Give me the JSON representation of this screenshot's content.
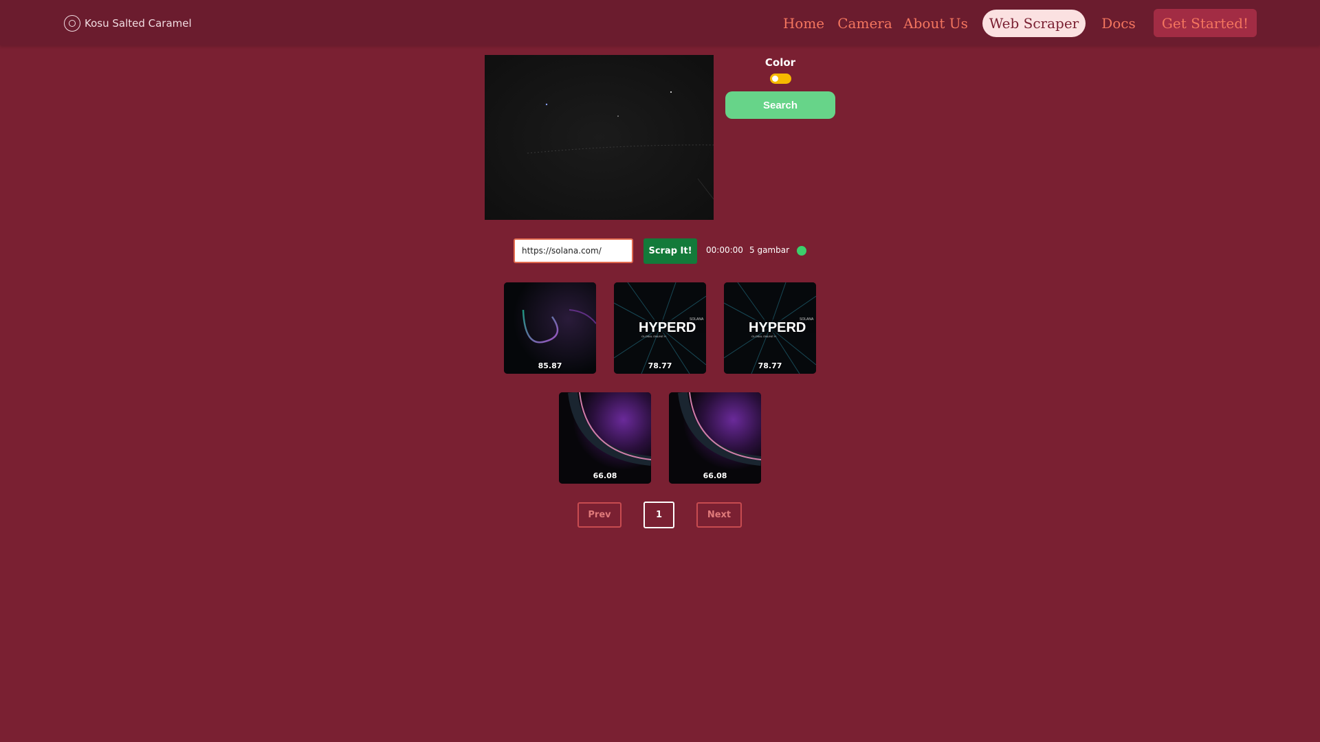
{
  "brand": {
    "name": "Kosu Salted Caramel",
    "icon": "logo-icon"
  },
  "nav": {
    "home": "Home",
    "camera": "Camera",
    "about": "About Us",
    "scraper": "Web Scraper",
    "docs": "Docs",
    "cta": "Get Started!"
  },
  "camera_panel": {
    "color_label": "Color",
    "color_toggle_on": true,
    "search_label": "Search"
  },
  "scraper": {
    "url_value": "https://solana.com/",
    "button_label": "Scrap It!",
    "timer": "00:00:00",
    "count": "5 gambar",
    "status_color": "#3dce6c"
  },
  "results": [
    {
      "score": "85.87",
      "image": "aurora-arc"
    },
    {
      "score": "78.77",
      "image": "hyperdrive-banner"
    },
    {
      "score": "78.77",
      "image": "hyperdrive-banner"
    },
    {
      "score": "66.08",
      "image": "purple-eclipse"
    },
    {
      "score": "66.08",
      "image": "purple-eclipse"
    }
  ],
  "pagination": {
    "prev": "Prev",
    "current": "1",
    "next": "Next"
  },
  "colors": {
    "background": "#7a2032",
    "navbar": "#6b1c2e",
    "nav_link": "#f4765f",
    "active_pill": "#fbe1e1",
    "cta": "#a22c44",
    "search_button": "#67d489",
    "scrap_button": "#137a3a",
    "toggle": "#f6b900"
  }
}
